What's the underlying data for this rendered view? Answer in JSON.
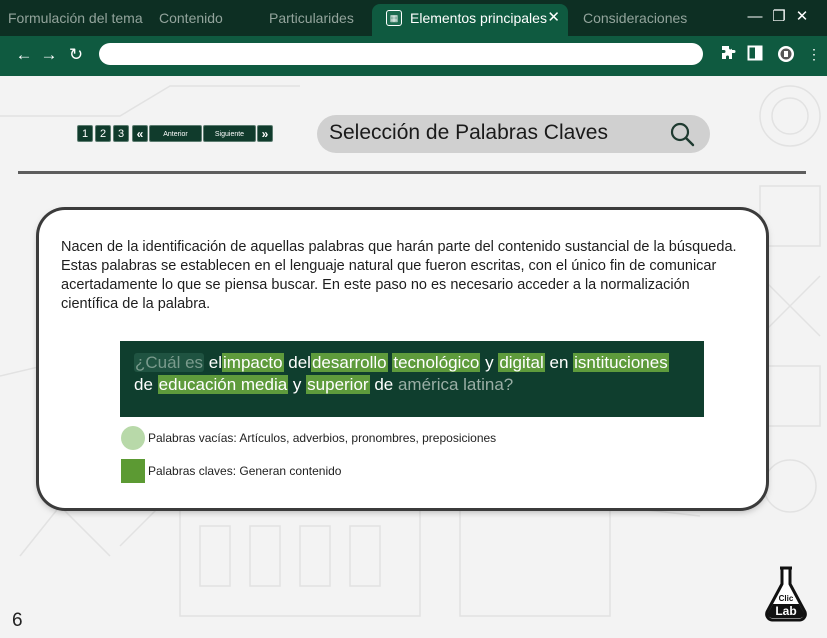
{
  "browser": {
    "tabs": [
      {
        "label": "Formulación del tema",
        "active": false
      },
      {
        "label": "Contenido",
        "active": false
      },
      {
        "label": "Particularides",
        "active": false
      },
      {
        "label": "Elementos principales",
        "active": true
      },
      {
        "label": "Consideraciones",
        "active": false
      }
    ],
    "address": ""
  },
  "pager": {
    "pages": [
      "1",
      "2",
      "3"
    ],
    "prev_label": "Anterior",
    "next_label": "Siguiente"
  },
  "header": {
    "title": "Selección de Palabras Claves"
  },
  "body": {
    "paragraph": "Nacen de la identificación de aquellas palabras que harán parte del contenido sustancial de la búsqueda. Estas palabras se establecen en el lenguaje natural que fueron escritas, con el único fin de comunicar acertadamente lo que se piensa buscar. En este paso no es necesario acceder a la normalización científica de la palabra."
  },
  "question": {
    "words": [
      {
        "text": "¿Cuál es",
        "kind": "empty"
      },
      {
        "text": "el",
        "kind": "plain"
      },
      {
        "text": "impacto",
        "kind": "key"
      },
      {
        "text": "del",
        "kind": "plain"
      },
      {
        "text": "desarrollo",
        "kind": "key"
      },
      {
        "text": "tecnológico",
        "kind": "key"
      },
      {
        "text": "y",
        "kind": "plain"
      },
      {
        "text": "digital",
        "kind": "key"
      },
      {
        "text": "en",
        "kind": "plain"
      },
      {
        "text": "isntituciones",
        "kind": "key"
      },
      {
        "text": "de",
        "kind": "plain"
      },
      {
        "text": "educación media",
        "kind": "key"
      },
      {
        "text": "y",
        "kind": "plain"
      },
      {
        "text": "superior",
        "kind": "key"
      },
      {
        "text": "de",
        "kind": "plain"
      },
      {
        "text": "américa latina?",
        "kind": "dim"
      }
    ]
  },
  "legend": {
    "empty_words": "Palabras vacías: Artículos, adverbios, pronombres, preposiciones",
    "key_words": "Palabras claves: Generan contenido",
    "colors": {
      "empty": "#b8d9a9",
      "key": "#5c9a33"
    }
  },
  "footer": {
    "page_number": "6",
    "logo_text_top": "Clic",
    "logo_text_bottom": "Lab"
  }
}
